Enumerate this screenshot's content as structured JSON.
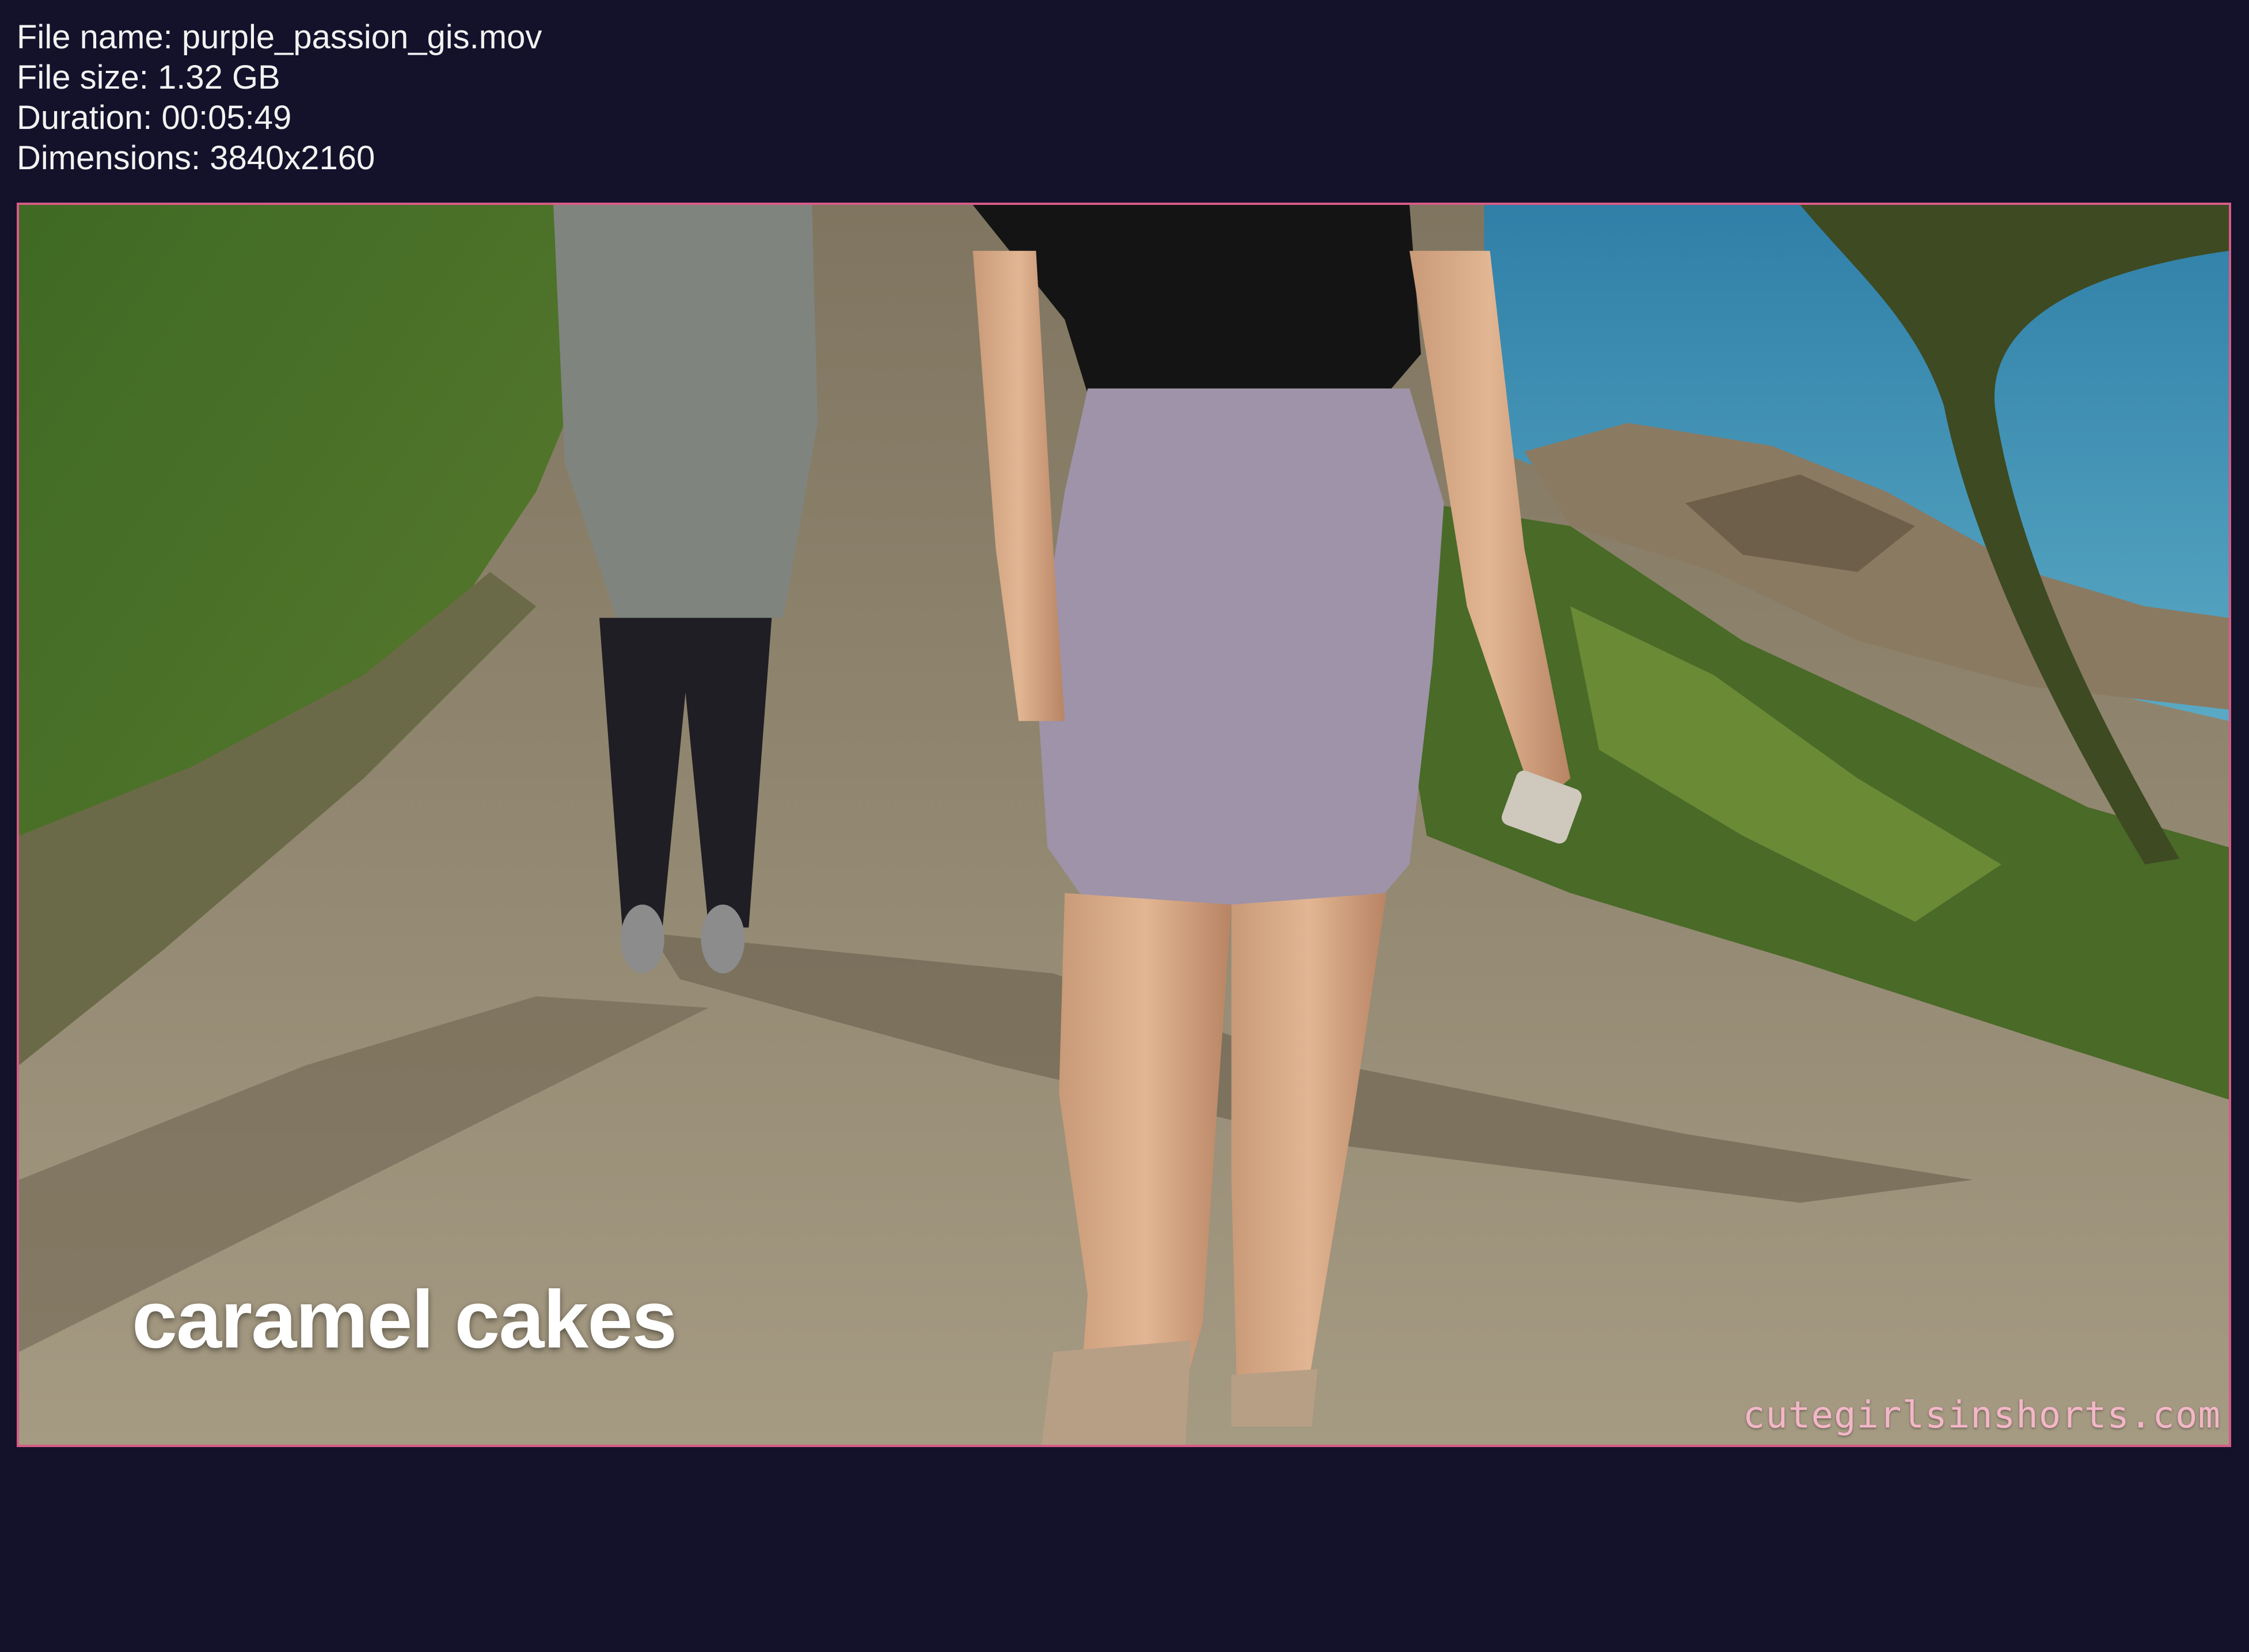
{
  "file_info": {
    "file_name": "File name: purple_passion_gis.mov",
    "file_size": "File size: 1.32 GB",
    "duration": "Duration: 00:05:49",
    "dimensions": "Dimensions: 3840x2160"
  },
  "video_frame": {
    "caption": "caramel cakes",
    "watermark": "cutegirlsinshorts.com"
  },
  "colors": {
    "background": "#14112b",
    "frame_border": "#d65c85",
    "watermark": "#f3b6c8"
  }
}
